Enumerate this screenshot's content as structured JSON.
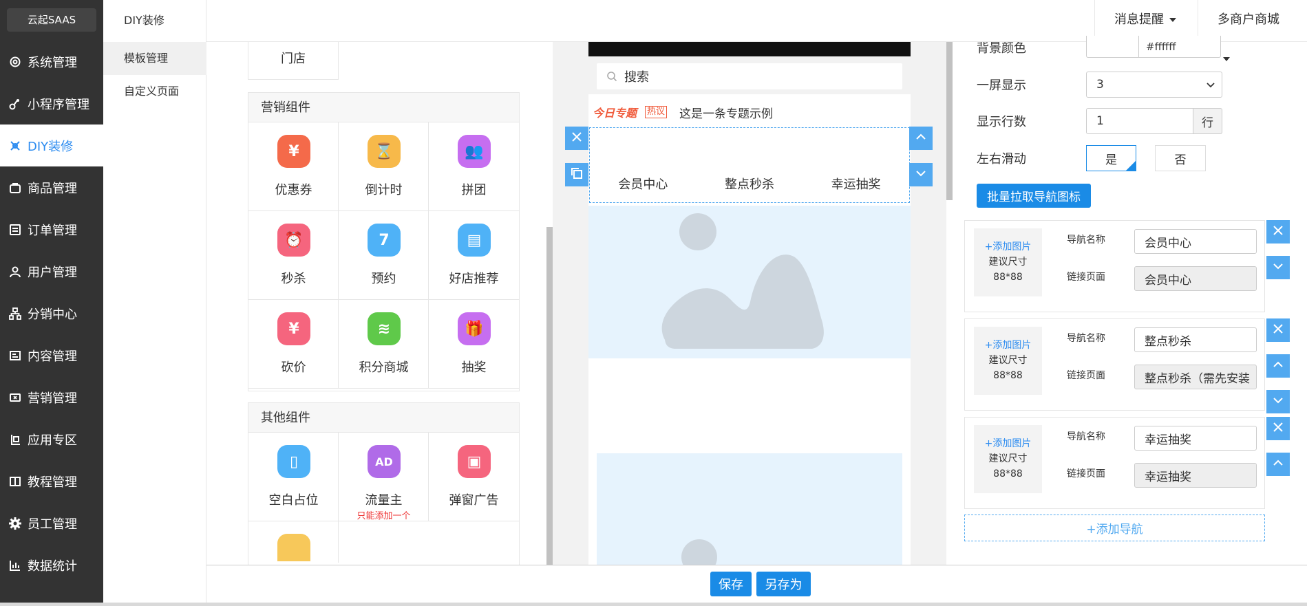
{
  "app": {
    "logo": "云起SAAS"
  },
  "sidebar": {
    "items": [
      {
        "label": "系统管理",
        "icon": "gear-outline-icon"
      },
      {
        "label": "小程序管理",
        "icon": "link-icon"
      },
      {
        "label": "DIY装修",
        "icon": "diy-icon"
      },
      {
        "label": "商品管理",
        "icon": "bag-icon"
      },
      {
        "label": "订单管理",
        "icon": "list-icon"
      },
      {
        "label": "用户管理",
        "icon": "user-icon"
      },
      {
        "label": "分销中心",
        "icon": "org-icon"
      },
      {
        "label": "内容管理",
        "icon": "content-icon"
      },
      {
        "label": "营销管理",
        "icon": "ticket-icon"
      },
      {
        "label": "应用专区",
        "icon": "app-icon"
      },
      {
        "label": "教程管理",
        "icon": "book-icon"
      },
      {
        "label": "员工管理",
        "icon": "gear-solid-icon"
      },
      {
        "label": "数据统计",
        "icon": "chart-icon"
      }
    ],
    "active_index": 2
  },
  "subnav": {
    "title": "DIY装修",
    "items": [
      "模板管理",
      "自定义页面"
    ]
  },
  "topbar": {
    "messages": "消息提醒",
    "merchant": "多商户商城"
  },
  "components": {
    "store_label": "门店",
    "marketing": {
      "title": "营销组件",
      "items": [
        {
          "label": "优惠券",
          "icon": "coupon-icon",
          "color": "#f46a4a",
          "glyph": "¥"
        },
        {
          "label": "倒计时",
          "icon": "hourglass-icon",
          "color": "#f7b94a",
          "glyph": "⌛"
        },
        {
          "label": "拼团",
          "icon": "group-icon",
          "color": "#c66ef0",
          "glyph": "👥"
        },
        {
          "label": "秒杀",
          "icon": "alarm-clock-icon",
          "color": "#f5657e",
          "glyph": "⏰"
        },
        {
          "label": "预约",
          "icon": "calendar-icon",
          "color": "#4fb2f7",
          "glyph": "7"
        },
        {
          "label": "好店推荐",
          "icon": "shop-icon",
          "color": "#4fb2f7",
          "glyph": "▤"
        },
        {
          "label": "砍价",
          "icon": "yen-icon",
          "color": "#f5657e",
          "glyph": "¥"
        },
        {
          "label": "积分商城",
          "icon": "coins-icon",
          "color": "#5fc94a",
          "glyph": "≋"
        },
        {
          "label": "抽奖",
          "icon": "gift-icon",
          "color": "#c66ef0",
          "glyph": "🎁"
        }
      ]
    },
    "other": {
      "title": "其他组件",
      "items": [
        {
          "label": "空白占位",
          "icon": "file-icon",
          "color": "#4fb2f7",
          "glyph": "▯"
        },
        {
          "label": "流量主",
          "icon": "ad-icon",
          "color": "#b06be8",
          "glyph": "AD",
          "note": "只能添加一个"
        },
        {
          "label": "弹窗广告",
          "icon": "popup-icon",
          "color": "#f5657e",
          "glyph": "▣"
        }
      ]
    }
  },
  "preview": {
    "search_placeholder": "搜索",
    "topic_brand": "今日专题",
    "topic_tag": "热议",
    "topic_text": "这是一条专题示例",
    "nav_items": [
      "会员中心",
      "整点秒杀",
      "幸运抽奖"
    ]
  },
  "settings": {
    "bg_color_label": "背景颜色",
    "bg_color_value": "#ffffff",
    "per_screen_label": "一屏显示",
    "per_screen_value": "3",
    "rows_label": "显示行数",
    "rows_value": "1",
    "rows_unit": "行",
    "slide_label": "左右滑动",
    "slide_yes": "是",
    "slide_no": "否",
    "batch_btn": "批量拉取导航图标",
    "add_nav": "+添加导航",
    "nav_cards": [
      {
        "add_img": "+添加图片",
        "size_hint": "建议尺寸",
        "size": "88*88",
        "name_label": "导航名称",
        "name": "会员中心",
        "link_label": "链接页面",
        "link": "会员中心"
      },
      {
        "add_img": "+添加图片",
        "size_hint": "建议尺寸",
        "size": "88*88",
        "name_label": "导航名称",
        "name": "整点秒杀",
        "link_label": "链接页面",
        "link": "整点秒杀（需先安装"
      },
      {
        "add_img": "+添加图片",
        "size_hint": "建议尺寸",
        "size": "88*88",
        "name_label": "导航名称",
        "name": "幸运抽奖",
        "link_label": "链接页面",
        "link": "幸运抽奖"
      }
    ]
  },
  "footer": {
    "save": "保存",
    "save_as": "另存为"
  },
  "colors": {
    "sidebar_bg": "#333333",
    "accent": "#1a8be6",
    "selection": "#52a9f0",
    "placeholder_bg": "#e6f3fd"
  }
}
